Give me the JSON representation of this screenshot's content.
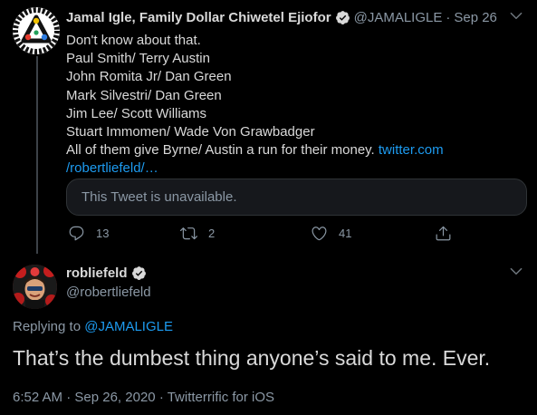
{
  "colors": {
    "background": "#000000",
    "text": "#d9d9d9",
    "secondary": "#8b98a5",
    "link": "#1d9bf0",
    "quote_bg": "#16181c"
  },
  "tweet1": {
    "author_name": "Jamal Igle, Family Dollar Chiwetel Ejiofor",
    "verified_icon": "verified-badge-icon",
    "handle": "@JAMALIGLE",
    "separator": "·",
    "date": "Sep 26",
    "lines": [
      "Don't know about that.",
      "Paul Smith/ Terry Austin",
      "John Romita Jr/ Dan Green",
      "Mark Silvestri/ Dan Green",
      "Jim Lee/ Scott Williams",
      "Stuart Immomen/ Wade Von Grawbadger"
    ],
    "last_line_text": "All of them give Byrne/ Austin a run for their money.",
    "link_part1": "twitter.com",
    "link_part2": "/robertliefeld/…",
    "quoted_unavailable": "This Tweet is unavailable.",
    "reply_count": "13",
    "retweet_count": "2",
    "like_count": "41"
  },
  "tweet2": {
    "author_name": "robliefeld",
    "handle": "@robertliefeld",
    "replying_prefix": "Replying to",
    "replying_to": "@JAMALIGLE",
    "text": "That’s the dumbest thing anyone’s said to me. Ever.",
    "time": "6:52 AM",
    "separator1": "·",
    "date": "Sep 26, 2020",
    "separator2": "·",
    "client": "Twitterrific for iOS"
  }
}
